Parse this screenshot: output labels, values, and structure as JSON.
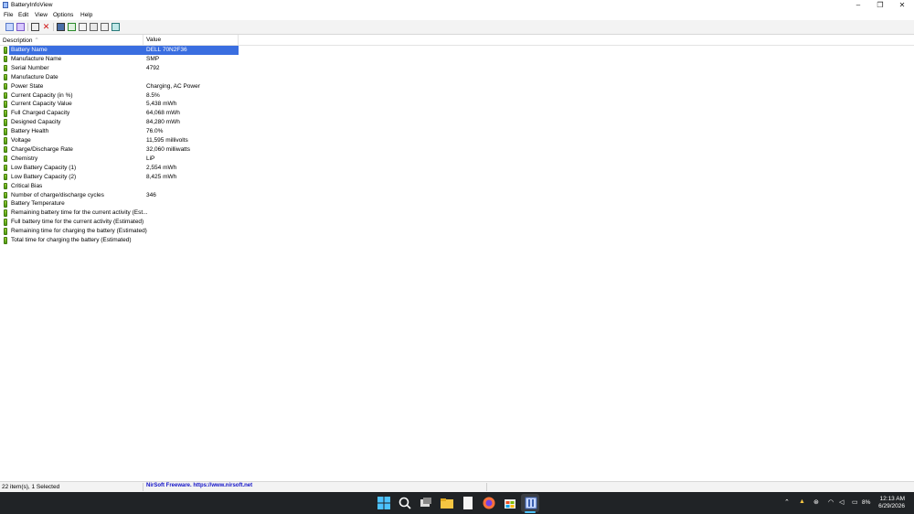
{
  "window": {
    "title": "BatteryInfoView"
  },
  "menu": [
    "File",
    "Edit",
    "View",
    "Options",
    "Help"
  ],
  "columns": {
    "description": "Description",
    "value": "Value"
  },
  "rows": [
    {
      "desc": "Battery Name",
      "value": "DELL 70N2F36"
    },
    {
      "desc": "Manufacture Name",
      "value": "SMP"
    },
    {
      "desc": "Serial Number",
      "value": "4792"
    },
    {
      "desc": "Manufacture Date",
      "value": ""
    },
    {
      "desc": "Power State",
      "value": "Charging, AC Power"
    },
    {
      "desc": "Current Capacity (in %)",
      "value": "8.5%"
    },
    {
      "desc": "Current Capacity Value",
      "value": "5,438 mWh"
    },
    {
      "desc": "Full Charged Capacity",
      "value": "64,068 mWh"
    },
    {
      "desc": "Designed Capacity",
      "value": "84,280 mWh"
    },
    {
      "desc": "Battery Health",
      "value": "76.0%"
    },
    {
      "desc": "Voltage",
      "value": "11,595 millivolts"
    },
    {
      "desc": "Charge/Discharge Rate",
      "value": "32,060 milliwatts"
    },
    {
      "desc": "Chemistry",
      "value": "LiP"
    },
    {
      "desc": "Low Battery Capacity (1)",
      "value": "2,554 mWh"
    },
    {
      "desc": "Low Battery Capacity (2)",
      "value": "8,425 mWh"
    },
    {
      "desc": "Critical Bias",
      "value": ""
    },
    {
      "desc": "Number of charge/discharge cycles",
      "value": "346"
    },
    {
      "desc": "Battery Temperature",
      "value": ""
    },
    {
      "desc": "Remaining battery time for the current activity (Est...",
      "value": ""
    },
    {
      "desc": "Full battery time for the current activity (Estimated)",
      "value": ""
    },
    {
      "desc": "Remaining time for charging the battery (Estimated)",
      "value": ""
    },
    {
      "desc": "Total  time for charging the battery (Estimated)",
      "value": ""
    }
  ],
  "selected_index": 0,
  "status": {
    "count": "22 item(s), 1 Selected",
    "credit": "NirSoft Freeware. https://www.nirsoft.net"
  },
  "tray": {
    "battery_pct": "8%",
    "time": "12:13 AM",
    "date": "6/29/2026"
  },
  "colors": {
    "selection": "#3a6ee0",
    "taskbar": "#202326",
    "credit_link": "#1010c8"
  }
}
